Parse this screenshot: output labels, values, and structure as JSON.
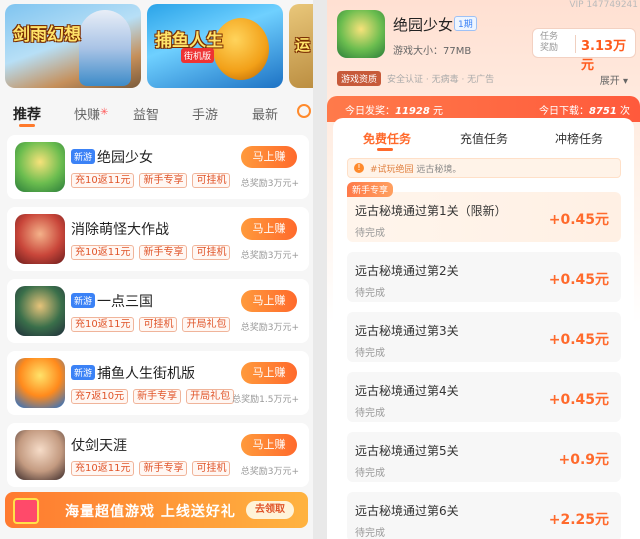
{
  "banners": [
    {
      "title": "剑雨幻想"
    },
    {
      "title": "捕鱼人生",
      "subtitle": "街机版"
    },
    {
      "title": "运"
    }
  ],
  "tabs": [
    {
      "label": "推荐",
      "active": true
    },
    {
      "label": "快赚"
    },
    {
      "label": "益智"
    },
    {
      "label": "手游"
    },
    {
      "label": "最新"
    }
  ],
  "games": [
    {
      "name": "绝园少女",
      "new": true,
      "new_label": "新游",
      "tags": [
        "充10返11元",
        "新手专享",
        "可挂机"
      ],
      "button": "马上赚",
      "reward": "总奖励3万元+"
    },
    {
      "name": "消除萌怪大作战",
      "new": false,
      "tags": [
        "充10返11元",
        "新手专享",
        "可挂机"
      ],
      "button": "马上赚",
      "reward": "总奖励3万元+"
    },
    {
      "name": "一点三国",
      "new": true,
      "new_label": "新游",
      "tags": [
        "充10返11元",
        "可挂机",
        "开局礼包"
      ],
      "button": "马上赚",
      "reward": "总奖励3万元+"
    },
    {
      "name": "捕鱼人生街机版",
      "new": true,
      "new_label": "新游",
      "tags": [
        "充7返10元",
        "新手专享",
        "开局礼包"
      ],
      "button": "马上赚",
      "reward": "总奖励1.5万元+"
    },
    {
      "name": "仗剑天涯",
      "new": false,
      "tags": [
        "充10返11元",
        "新手专享",
        "可挂机"
      ],
      "button": "马上赚",
      "reward": "总奖励3万元+"
    }
  ],
  "promo": {
    "text": "海量超值游戏  上线送好礼",
    "button": "去领取"
  },
  "detail": {
    "vip": "VIP 147749241",
    "title": "绝园少女",
    "period": "1期",
    "size": "游戏大小：77MB",
    "reward_label": "任务奖励",
    "reward_value": "3.13万元",
    "type": "游戏资质",
    "certs": "安全认证 · 无病毒 · 无广告",
    "expand": "展开 ▾",
    "stats_today_pay": "今日发奖：",
    "stats_today_pay_value": "11928",
    "stats_unit": "元",
    "stats_today_dl": "今日下载：",
    "stats_today_dl_value": "8751",
    "stats_dl_unit": "次",
    "tabs": [
      {
        "label": "免费任务",
        "active": true
      },
      {
        "label": "充值任务"
      },
      {
        "label": "冲榜任务"
      }
    ],
    "notice_tag": "#试玩绝园",
    "notice_text": "远古秘境。",
    "newbie_label": "新手专享",
    "tasks": [
      {
        "name": "远古秘境通过第1关（限新）",
        "status": "待完成",
        "value": "+0.45元"
      },
      {
        "name": "远古秘境通过第2关",
        "status": "待完成",
        "value": "+0.45元"
      },
      {
        "name": "远古秘境通过第3关",
        "status": "待完成",
        "value": "+0.45元"
      },
      {
        "name": "远古秘境通过第4关",
        "status": "待完成",
        "value": "+0.45元"
      },
      {
        "name": "远古秘境通过第5关",
        "status": "待完成",
        "value": "+0.9元"
      },
      {
        "name": "远古秘境通过第6关",
        "status": "待完成",
        "value": "+2.25元"
      }
    ]
  }
}
